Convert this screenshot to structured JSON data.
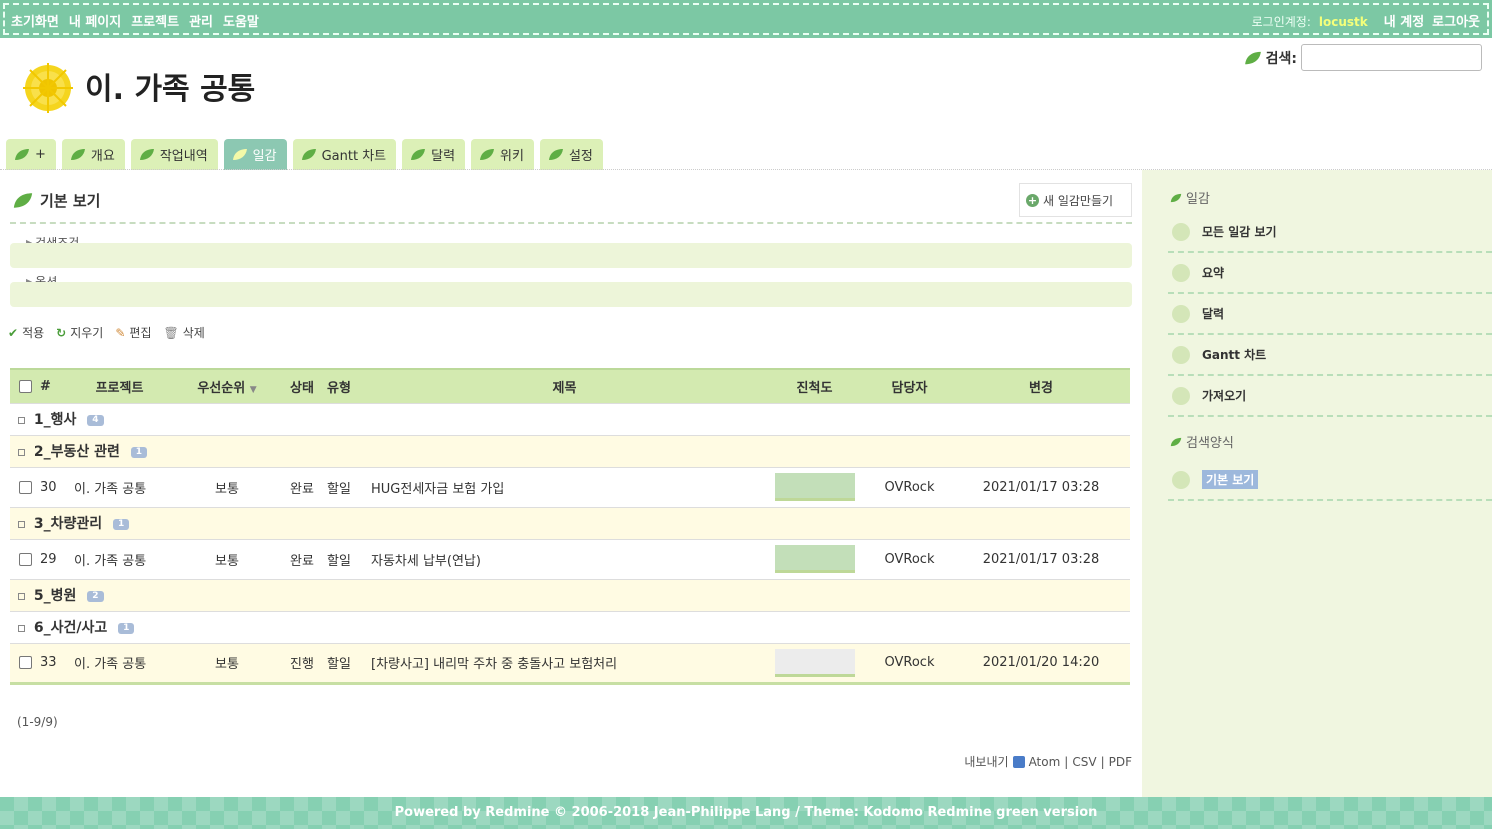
{
  "top_menu": {
    "left": [
      "초기화면",
      "내 페이지",
      "프로젝트",
      "관리",
      "도움말"
    ],
    "login_label": "로그인계정:",
    "login_user": "locustk",
    "my_account": "내 계정",
    "logout": "로그아웃"
  },
  "header": {
    "project_title": "이. 가족 공통",
    "search_label": "검색:",
    "search_value": ""
  },
  "tabs": [
    {
      "label": "+",
      "selected": false
    },
    {
      "label": "개요",
      "selected": false
    },
    {
      "label": "작업내역",
      "selected": false
    },
    {
      "label": "일감",
      "selected": true
    },
    {
      "label": "Gantt 차트",
      "selected": false
    },
    {
      "label": "달력",
      "selected": false
    },
    {
      "label": "위키",
      "selected": false
    },
    {
      "label": "설정",
      "selected": false
    }
  ],
  "content": {
    "title": "기본 보기",
    "new_query": "새 일감만들기",
    "filters_label": "검색조건",
    "options_label": "옵션",
    "actions": [
      "적용",
      "지우기",
      "편집",
      "삭제"
    ]
  },
  "table": {
    "headers": [
      "#",
      "프로젝트",
      "우선순위",
      "상태",
      "유형",
      "제목",
      "진척도",
      "담당자",
      "변경"
    ],
    "rows": [
      {
        "kind": "group",
        "name": "1_행사",
        "count": "4"
      },
      {
        "kind": "group",
        "name": "2_부동산 관련",
        "count": "1"
      },
      {
        "kind": "issue",
        "id": "30",
        "project": "이. 가족 공통",
        "priority": "보통",
        "status": "완료",
        "tracker": "할일",
        "subject": "HUG전세자금 보험 가입",
        "progress": 100,
        "assignee": "OVRock",
        "updated": "2021/01/17 03:28"
      },
      {
        "kind": "group",
        "name": "3_차량관리",
        "count": "1"
      },
      {
        "kind": "issue",
        "id": "29",
        "project": "이. 가족 공통",
        "priority": "보통",
        "status": "완료",
        "tracker": "할일",
        "subject": "자동차세 납부(연납)",
        "progress": 100,
        "assignee": "OVRock",
        "updated": "2021/01/17 03:28"
      },
      {
        "kind": "group",
        "name": "5_병원",
        "count": "2"
      },
      {
        "kind": "group",
        "name": "6_사건/사고",
        "count": "1"
      },
      {
        "kind": "issue",
        "id": "33",
        "project": "이. 가족 공통",
        "priority": "보통",
        "status": "진행",
        "tracker": "할일",
        "subject": "[차량사고] 내리막 주차 중 충돌사고 보험처리",
        "progress": 0,
        "assignee": "OVRock",
        "updated": "2021/01/20 14:20"
      }
    ]
  },
  "pagination": "(1-9/9)",
  "export": {
    "label": "내보내기",
    "atom": "Atom",
    "csv": "CSV",
    "pdf": "PDF"
  },
  "sidebar": {
    "issues_heading": "일감",
    "items": [
      "모든 일감 보기",
      "요약",
      "달력",
      "Gantt 차트",
      "가져오기"
    ],
    "queries_heading": "검색양식",
    "query_items": [
      "기본 보기"
    ]
  },
  "footer": "Powered by Redmine © 2006-2018 Jean-Philippe Lang / Theme: Kodomo Redmine green version",
  "colors": {
    "top_menu": "#7cc8a4",
    "tab": "#dcf0b7",
    "tab_selected": "#8cc8b2",
    "sidebar": "#f0f6e0",
    "table_header": "#d3eab0"
  }
}
